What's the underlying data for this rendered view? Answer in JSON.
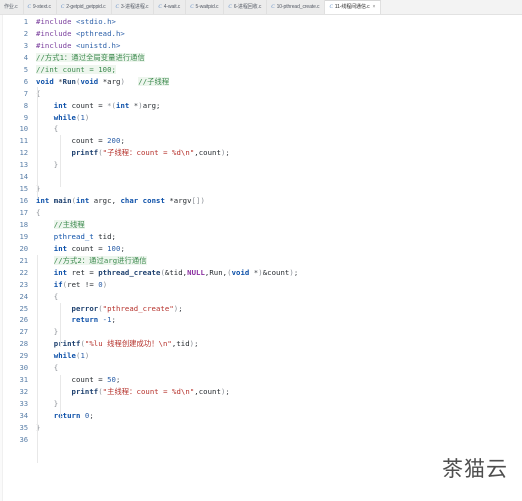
{
  "tabbar": {
    "tabs": [
      {
        "label": "作业.c",
        "icon": "c-file-icon",
        "active": false,
        "prefix": false
      },
      {
        "label": "9-stext.c",
        "icon": "c-file-icon",
        "active": false,
        "prefix": true
      },
      {
        "label": "2-getpid_getppid.c",
        "icon": "c-file-icon",
        "active": false,
        "prefix": true
      },
      {
        "label": "3-进程进程.c",
        "icon": "c-file-icon",
        "active": false,
        "prefix": true
      },
      {
        "label": "4-wait.c",
        "icon": "c-file-icon",
        "active": false,
        "prefix": true
      },
      {
        "label": "5-waitpid.c",
        "icon": "c-file-icon",
        "active": false,
        "prefix": true
      },
      {
        "label": "6-进程回收.c",
        "icon": "c-file-icon",
        "active": false,
        "prefix": true
      },
      {
        "label": "10-pthread_create.c",
        "icon": "c-file-icon",
        "active": false,
        "prefix": true
      },
      {
        "label": "11-线程间通信.c",
        "icon": "c-file-icon",
        "active": true,
        "prefix": true
      }
    ],
    "c_glyph": "C",
    "close_glyph": "×"
  },
  "editor": {
    "lines": [
      {
        "n": 1,
        "tokens": [
          {
            "t": "#include ",
            "c": "tok-pre"
          },
          {
            "t": "<stdio.h>",
            "c": "tok-hdr"
          }
        ]
      },
      {
        "n": 2,
        "tokens": [
          {
            "t": "#include ",
            "c": "tok-pre"
          },
          {
            "t": "<pthread.h>",
            "c": "tok-hdr"
          }
        ]
      },
      {
        "n": 3,
        "tokens": [
          {
            "t": "#include ",
            "c": "tok-pre"
          },
          {
            "t": "<unistd.h>",
            "c": "tok-hdr"
          }
        ]
      },
      {
        "n": 4,
        "tokens": [
          {
            "t": "//方式1：通过全局变量进行通信",
            "c": "tok-cmt"
          }
        ]
      },
      {
        "n": 5,
        "tokens": [
          {
            "t": "//int count = 100;",
            "c": "tok-cmt"
          }
        ]
      },
      {
        "n": 6,
        "tokens": [
          {
            "t": "void ",
            "c": "tok-kw"
          },
          {
            "t": "*",
            "c": "tok-pl"
          },
          {
            "t": "Run",
            "c": "tok-fn"
          },
          {
            "t": "(",
            "c": "tok-br"
          },
          {
            "t": "void ",
            "c": "tok-kw"
          },
          {
            "t": "*arg",
            "c": "tok-id"
          },
          {
            "t": ")",
            "c": "tok-br"
          },
          {
            "t": "   ",
            "c": "tok-pl"
          },
          {
            "t": "//子线程",
            "c": "tok-cmt"
          }
        ]
      },
      {
        "n": 7,
        "tokens": [
          {
            "t": "{",
            "c": "tok-br"
          }
        ]
      },
      {
        "n": 8,
        "tokens": [
          {
            "t": "    ",
            "c": "tok-pl"
          },
          {
            "t": "int ",
            "c": "tok-kw"
          },
          {
            "t": "count = ",
            "c": "tok-id"
          },
          {
            "t": "*(",
            "c": "tok-br"
          },
          {
            "t": "int ",
            "c": "tok-kw"
          },
          {
            "t": "*",
            "c": "tok-pl"
          },
          {
            "t": ")",
            "c": "tok-br"
          },
          {
            "t": "arg;",
            "c": "tok-id"
          }
        ]
      },
      {
        "n": 9,
        "tokens": [
          {
            "t": "    ",
            "c": "tok-pl"
          },
          {
            "t": "while",
            "c": "tok-kw"
          },
          {
            "t": "(",
            "c": "tok-br"
          },
          {
            "t": "1",
            "c": "tok-num"
          },
          {
            "t": ")",
            "c": "tok-br"
          }
        ]
      },
      {
        "n": 10,
        "tokens": [
          {
            "t": "    ",
            "c": "tok-pl"
          },
          {
            "t": "{",
            "c": "tok-br"
          }
        ]
      },
      {
        "n": 11,
        "tokens": [
          {
            "t": "        ",
            "c": "tok-pl"
          },
          {
            "t": "count = ",
            "c": "tok-id"
          },
          {
            "t": "200",
            "c": "tok-num"
          },
          {
            "t": ";",
            "c": "tok-pl"
          }
        ]
      },
      {
        "n": 12,
        "tokens": [
          {
            "t": "        ",
            "c": "tok-pl"
          },
          {
            "t": "printf",
            "c": "tok-fn"
          },
          {
            "t": "(",
            "c": "tok-br"
          },
          {
            "t": "\"子线程：count = %d\\n\"",
            "c": "tok-str"
          },
          {
            "t": ",count",
            "c": "tok-id"
          },
          {
            "t": ")",
            "c": "tok-br"
          },
          {
            "t": ";",
            "c": "tok-pl"
          }
        ]
      },
      {
        "n": 13,
        "tokens": [
          {
            "t": "    ",
            "c": "tok-pl"
          },
          {
            "t": "}",
            "c": "tok-br"
          }
        ]
      },
      {
        "n": 14,
        "tokens": []
      },
      {
        "n": 15,
        "tokens": [
          {
            "t": "}",
            "c": "tok-br"
          }
        ]
      },
      {
        "n": 16,
        "tokens": [
          {
            "t": "int ",
            "c": "tok-kw"
          },
          {
            "t": "main",
            "c": "tok-fn"
          },
          {
            "t": "(",
            "c": "tok-br"
          },
          {
            "t": "int ",
            "c": "tok-kw"
          },
          {
            "t": "argc, ",
            "c": "tok-id"
          },
          {
            "t": "char const ",
            "c": "tok-kw"
          },
          {
            "t": "*argv",
            "c": "tok-id"
          },
          {
            "t": "[])",
            "c": "tok-br"
          }
        ]
      },
      {
        "n": 17,
        "tokens": [
          {
            "t": "{",
            "c": "tok-br"
          }
        ]
      },
      {
        "n": 18,
        "tokens": [
          {
            "t": "    ",
            "c": "tok-pl"
          },
          {
            "t": "//主线程",
            "c": "tok-cmt"
          }
        ]
      },
      {
        "n": 19,
        "tokens": [
          {
            "t": "    ",
            "c": "tok-pl"
          },
          {
            "t": "pthread_t",
            "c": "tok-type"
          },
          {
            "t": " tid;",
            "c": "tok-id"
          }
        ]
      },
      {
        "n": 20,
        "tokens": [
          {
            "t": "    ",
            "c": "tok-pl"
          },
          {
            "t": "int ",
            "c": "tok-kw"
          },
          {
            "t": "count = ",
            "c": "tok-id"
          },
          {
            "t": "100",
            "c": "tok-num"
          },
          {
            "t": ";",
            "c": "tok-pl"
          }
        ]
      },
      {
        "n": 21,
        "tokens": [
          {
            "t": "    ",
            "c": "tok-pl"
          },
          {
            "t": "//方式2：通过arg进行通信",
            "c": "tok-cmt"
          }
        ]
      },
      {
        "n": 22,
        "tokens": [
          {
            "t": "    ",
            "c": "tok-pl"
          },
          {
            "t": "int ",
            "c": "tok-kw"
          },
          {
            "t": "ret = ",
            "c": "tok-id"
          },
          {
            "t": "pthread_create",
            "c": "tok-fn"
          },
          {
            "t": "(",
            "c": "tok-br"
          },
          {
            "t": "&tid,",
            "c": "tok-id"
          },
          {
            "t": "NULL",
            "c": "tok-null"
          },
          {
            "t": ",Run,",
            "c": "tok-id"
          },
          {
            "t": "(",
            "c": "tok-br"
          },
          {
            "t": "void ",
            "c": "tok-kw"
          },
          {
            "t": "*",
            "c": "tok-pl"
          },
          {
            "t": ")",
            "c": "tok-br"
          },
          {
            "t": "&count",
            "c": "tok-id"
          },
          {
            "t": ")",
            "c": "tok-br"
          },
          {
            "t": ";",
            "c": "tok-pl"
          }
        ]
      },
      {
        "n": 23,
        "tokens": [
          {
            "t": "    ",
            "c": "tok-pl"
          },
          {
            "t": "if",
            "c": "tok-kw"
          },
          {
            "t": "(",
            "c": "tok-br"
          },
          {
            "t": "ret != ",
            "c": "tok-id"
          },
          {
            "t": "0",
            "c": "tok-num"
          },
          {
            "t": ")",
            "c": "tok-br"
          }
        ]
      },
      {
        "n": 24,
        "tokens": [
          {
            "t": "    ",
            "c": "tok-pl"
          },
          {
            "t": "{",
            "c": "tok-br"
          }
        ]
      },
      {
        "n": 25,
        "tokens": [
          {
            "t": "        ",
            "c": "tok-pl"
          },
          {
            "t": "perror",
            "c": "tok-fn"
          },
          {
            "t": "(",
            "c": "tok-br"
          },
          {
            "t": "\"pthread_create\"",
            "c": "tok-str"
          },
          {
            "t": ")",
            "c": "tok-br"
          },
          {
            "t": ";",
            "c": "tok-pl"
          }
        ]
      },
      {
        "n": 26,
        "tokens": [
          {
            "t": "        ",
            "c": "tok-pl"
          },
          {
            "t": "return ",
            "c": "tok-kw"
          },
          {
            "t": "-1",
            "c": "tok-num"
          },
          {
            "t": ";",
            "c": "tok-pl"
          }
        ]
      },
      {
        "n": 27,
        "tokens": [
          {
            "t": "    ",
            "c": "tok-pl"
          },
          {
            "t": "}",
            "c": "tok-br"
          }
        ]
      },
      {
        "n": 28,
        "tokens": [
          {
            "t": "    ",
            "c": "tok-pl"
          },
          {
            "t": "printf",
            "c": "tok-fn"
          },
          {
            "t": "(",
            "c": "tok-br"
          },
          {
            "t": "\"%lu 线程创建成功！\\n\"",
            "c": "tok-str"
          },
          {
            "t": ",tid",
            "c": "tok-id"
          },
          {
            "t": ")",
            "c": "tok-br"
          },
          {
            "t": ";",
            "c": "tok-pl"
          }
        ]
      },
      {
        "n": 29,
        "tokens": [
          {
            "t": "    ",
            "c": "tok-pl"
          },
          {
            "t": "while",
            "c": "tok-kw"
          },
          {
            "t": "(",
            "c": "tok-br"
          },
          {
            "t": "1",
            "c": "tok-num"
          },
          {
            "t": ")",
            "c": "tok-br"
          }
        ]
      },
      {
        "n": 30,
        "tokens": [
          {
            "t": "    ",
            "c": "tok-pl"
          },
          {
            "t": "{",
            "c": "tok-br"
          }
        ]
      },
      {
        "n": 31,
        "tokens": [
          {
            "t": "        ",
            "c": "tok-pl"
          },
          {
            "t": "count = ",
            "c": "tok-id"
          },
          {
            "t": "50",
            "c": "tok-num"
          },
          {
            "t": ";",
            "c": "tok-pl"
          }
        ]
      },
      {
        "n": 32,
        "tokens": [
          {
            "t": "        ",
            "c": "tok-pl"
          },
          {
            "t": "printf",
            "c": "tok-fn"
          },
          {
            "t": "(",
            "c": "tok-br"
          },
          {
            "t": "\"主线程：count = %d\\n\"",
            "c": "tok-str"
          },
          {
            "t": ",count",
            "c": "tok-id"
          },
          {
            "t": ")",
            "c": "tok-br"
          },
          {
            "t": ";",
            "c": "tok-pl"
          }
        ]
      },
      {
        "n": 33,
        "tokens": [
          {
            "t": "    ",
            "c": "tok-pl"
          },
          {
            "t": "}",
            "c": "tok-br"
          }
        ]
      },
      {
        "n": 34,
        "tokens": [
          {
            "t": "    ",
            "c": "tok-pl"
          },
          {
            "t": "return ",
            "c": "tok-kw"
          },
          {
            "t": "0",
            "c": "tok-num"
          },
          {
            "t": ";",
            "c": "tok-pl"
          }
        ]
      },
      {
        "n": 35,
        "tokens": [
          {
            "t": "}",
            "c": "tok-br"
          }
        ]
      },
      {
        "n": 36,
        "tokens": []
      }
    ]
  },
  "watermark": {
    "text": "茶猫云"
  }
}
